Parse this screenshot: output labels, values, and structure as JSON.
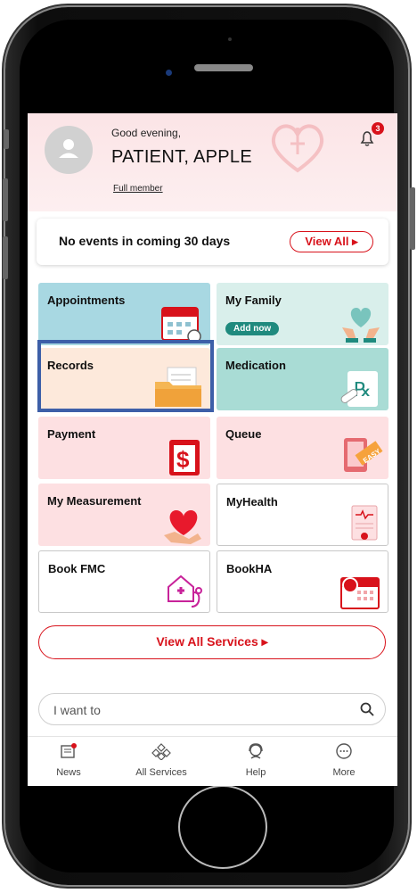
{
  "header": {
    "greeting": "Good evening,",
    "patient_name": "PATIENT, APPLE",
    "membership": "Full member",
    "notification_count": "3"
  },
  "events": {
    "message": "No events in coming 30 days",
    "view_all_label": "View All ▸"
  },
  "tiles": [
    {
      "label": "Appointments",
      "bg": "#a8d8e2",
      "icon": "calendar-icon"
    },
    {
      "label": "My Family",
      "bg": "#d9efeb",
      "icon": "heart-hands-icon",
      "action": "Add now"
    },
    {
      "label": "Records",
      "bg": "#fde9db",
      "icon": "folder-icon"
    },
    {
      "label": "Medication",
      "bg": "#a9dcd5",
      "icon": "prescription-icon"
    },
    {
      "label": "Payment",
      "bg": "#fde0e2",
      "icon": "payment-icon"
    },
    {
      "label": "Queue",
      "bg": "#fde0e2",
      "icon": "queue-ticket-icon"
    },
    {
      "label": "My Measurement",
      "bg": "#fde0e2",
      "icon": "heart-measure-icon"
    },
    {
      "label": "MyHealth",
      "bg": "#ffffff",
      "icon": "health-record-icon"
    },
    {
      "label": "Book FMC",
      "bg": "#ffffff",
      "icon": "stethoscope-icon"
    },
    {
      "label": "BookHA",
      "bg": "#ffffff",
      "icon": "ha-calendar-icon"
    }
  ],
  "services_button": "View All Services ▸",
  "search": {
    "placeholder": "I want to"
  },
  "tabbar": [
    {
      "label": "News",
      "icon": "news-icon"
    },
    {
      "label": "All Services",
      "icon": "all-services-icon"
    },
    {
      "label": "Help",
      "icon": "help-icon"
    },
    {
      "label": "More",
      "icon": "more-icon"
    }
  ],
  "colors": {
    "accent": "#d8121b",
    "selection": "#3d5fa8",
    "teal": "#1f8a7e"
  }
}
